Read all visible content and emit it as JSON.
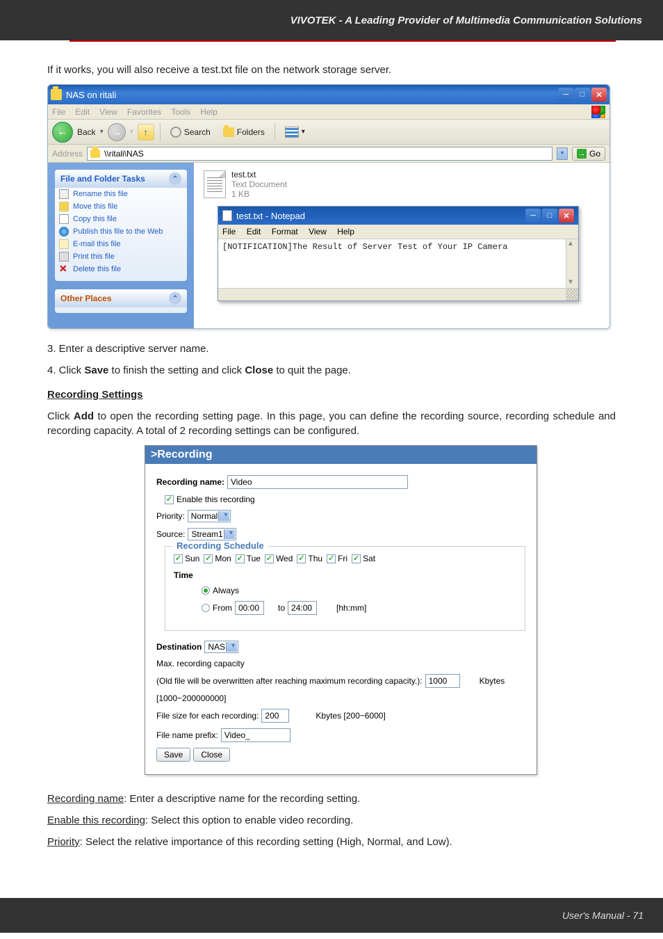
{
  "topbar": "VIVOTEK - A Leading Provider of Multimedia Communication Solutions",
  "intro": "If it works, you will also receive a test.txt file on the network storage server.",
  "explorer": {
    "title": "NAS on ritali",
    "menus": [
      "File",
      "Edit",
      "View",
      "Favorites",
      "Tools",
      "Help"
    ],
    "back": "Back",
    "dropdown": "▾",
    "search": "Search",
    "folders": "Folders",
    "viewsdrop": "▾",
    "address_label": "Address",
    "address_value": "\\\\ritali\\NAS",
    "go": "Go",
    "taskhead": "File and Folder Tasks",
    "tasks": {
      "rename": "Rename this file",
      "move": "Move this file",
      "copy": "Copy this file",
      "publish": "Publish this file to the Web",
      "email": "E-mail this file",
      "print": "Print this file",
      "delete": "Delete this file"
    },
    "other": "Other Places",
    "file": {
      "name": "test.txt",
      "type": "Text Document",
      "size": "1 KB"
    }
  },
  "notepad": {
    "title": "test.txt - Notepad",
    "menus": [
      "File",
      "Edit",
      "Format",
      "View",
      "Help"
    ],
    "body": "[NOTIFICATION]The Result of Server Test of Your IP Camera"
  },
  "steps": {
    "s3": "3. Enter a descriptive server name.",
    "s4a": "4. Click ",
    "s4b": "Save",
    "s4c": " to finish the setting and click ",
    "s4d": "Close",
    "s4e": " to quit the page."
  },
  "recset": {
    "heading": "Recording Settings",
    "text1a": "Click ",
    "text1b": "Add",
    "text1c": " to open the recording setting page. In this page, you can define the recording source, recording schedule and recording capacity. A total of 2 recording settings can be configured."
  },
  "rec": {
    "header": ">Recording",
    "name_label": "Recording name:",
    "name_value": "Video",
    "enable": "Enable this recording",
    "priority_label": "Priority:",
    "priority_value": "Normal",
    "source_label": "Source:",
    "source_value": "Stream1",
    "schedule_legend": "Recording Schedule",
    "days": [
      "Sun",
      "Mon",
      "Tue",
      "Wed",
      "Thu",
      "Fri",
      "Sat"
    ],
    "time_label": "Time",
    "always": "Always",
    "from_label": "From",
    "from_value": "00:00",
    "to_label": "to",
    "to_value": "24:00",
    "hhmm": "[hh:mm]",
    "dest_label": "Destination",
    "dest_value": "NAS",
    "maxcap": "Max. recording capacity",
    "oldfile": "(Old file will be overwritten after reaching maximum recording capacity.):",
    "oldfile_val": "1000",
    "kbytes": "Kbytes",
    "range": "[1000~200000000]",
    "fsize_label": "File size for each recording:",
    "fsize_value": "200",
    "fsize_suffix": "Kbytes [200~6000]",
    "prefix_label": "File name prefix:",
    "prefix_value": "Video_",
    "save": "Save",
    "close": "Close"
  },
  "bottom": {
    "l1a": "Recording name",
    "l1b": ": Enter a descriptive name for the recording setting.",
    "l2a": "Enable this recording",
    "l2b": ": Select this option to enable video recording.",
    "l3a": "Priority",
    "l3b": ": Select the relative importance of this recording setting (High, Normal, and Low)."
  },
  "footer": "User's Manual - 71"
}
